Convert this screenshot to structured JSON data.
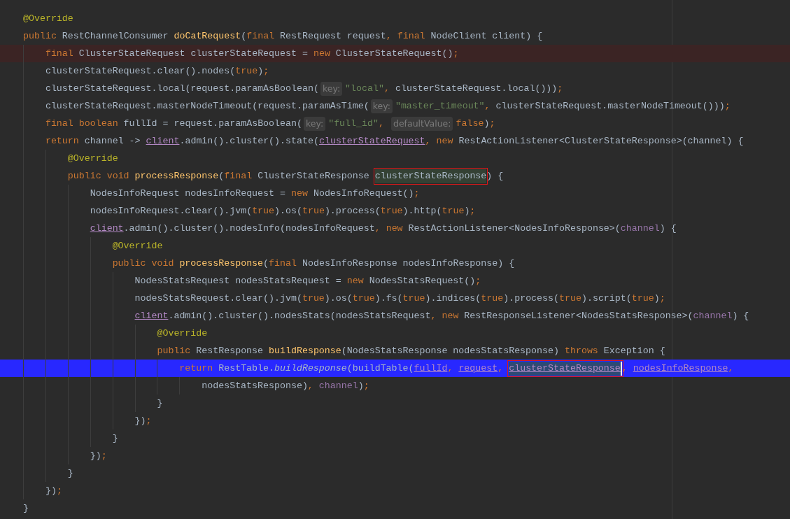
{
  "editor": {
    "lines": [
      {
        "kind": "normal",
        "tokens": [
          {
            "text": "@Override",
            "kind": "annotation"
          }
        ]
      },
      {
        "kind": "normal",
        "tokens": [
          {
            "text": "public",
            "kind": "keyword"
          },
          {
            "text": " RestChannelConsumer ",
            "kind": "plain"
          },
          {
            "text": "doCatRequest",
            "kind": "method"
          },
          {
            "text": "(",
            "kind": "plain"
          },
          {
            "text": "final",
            "kind": "keyword"
          },
          {
            "text": " RestRequest request",
            "kind": "plain"
          },
          {
            "text": ", ",
            "kind": "punct"
          },
          {
            "text": "final",
            "kind": "keyword"
          },
          {
            "text": " NodeClient client) {",
            "kind": "plain"
          }
        ],
        "children": [
          {
            "kind": "breakpoint",
            "tokens": [
              {
                "text": "final",
                "kind": "keyword"
              },
              {
                "text": " ClusterStateRequest clusterStateRequest = ",
                "kind": "plain"
              },
              {
                "text": "new",
                "kind": "keyword"
              },
              {
                "text": " ClusterStateRequest()",
                "kind": "plain"
              },
              {
                "text": ";",
                "kind": "punct"
              }
            ]
          },
          {
            "kind": "normal",
            "tokens": [
              {
                "text": "clusterStateRequest.clear().nodes(",
                "kind": "plain"
              },
              {
                "text": "true",
                "kind": "keyword"
              },
              {
                "text": ")",
                "kind": "plain"
              },
              {
                "text": ";",
                "kind": "punct"
              }
            ]
          },
          {
            "kind": "normal",
            "tokens": [
              {
                "text": "clusterStateRequest.local(request.paramAsBoolean(",
                "kind": "plain"
              },
              {
                "text": "key:",
                "kind": "hint"
              },
              {
                "text": "\"local\"",
                "kind": "string"
              },
              {
                "text": ", ",
                "kind": "punct"
              },
              {
                "text": "clusterStateRequest.local()))",
                "kind": "plain"
              },
              {
                "text": ";",
                "kind": "punct"
              }
            ]
          },
          {
            "kind": "normal",
            "tokens": [
              {
                "text": "clusterStateRequest.masterNodeTimeout(request.paramAsTime(",
                "kind": "plain"
              },
              {
                "text": "key:",
                "kind": "hint"
              },
              {
                "text": "\"master_timeout\"",
                "kind": "string"
              },
              {
                "text": ", ",
                "kind": "punct"
              },
              {
                "text": "clusterStateRequest.masterNodeTimeout()))",
                "kind": "plain"
              },
              {
                "text": ";",
                "kind": "punct"
              }
            ]
          },
          {
            "kind": "normal",
            "tokens": [
              {
                "text": "final boolean",
                "kind": "keyword"
              },
              {
                "text": " fullId = request.paramAsBoolean(",
                "kind": "plain"
              },
              {
                "text": "key:",
                "kind": "hint"
              },
              {
                "text": "\"full_id\"",
                "kind": "string"
              },
              {
                "text": ", ",
                "kind": "punct"
              },
              {
                "text": "defaultValue:",
                "kind": "hint"
              },
              {
                "text": "false",
                "kind": "keyword"
              },
              {
                "text": ")",
                "kind": "plain"
              },
              {
                "text": ";",
                "kind": "punct"
              }
            ]
          },
          {
            "kind": "normal",
            "tokens": [
              {
                "text": "return",
                "kind": "keyword"
              },
              {
                "text": " channel -> ",
                "kind": "plain"
              },
              {
                "text": "client",
                "kind": "link"
              },
              {
                "text": ".admin().cluster().state(",
                "kind": "plain"
              },
              {
                "text": "clusterStateRequest",
                "kind": "link"
              },
              {
                "text": ", ",
                "kind": "punct"
              },
              {
                "text": "new",
                "kind": "keyword"
              },
              {
                "text": " RestActionListener<ClusterStateResponse>(channel) {",
                "kind": "plain"
              }
            ],
            "children": [
              {
                "kind": "normal",
                "tokens": [
                  {
                    "text": "@Override",
                    "kind": "annotation"
                  }
                ]
              },
              {
                "kind": "normal",
                "tokens": [
                  {
                    "text": "public void ",
                    "kind": "keyword"
                  },
                  {
                    "text": "processResponse",
                    "kind": "method"
                  },
                  {
                    "text": "(",
                    "kind": "plain"
                  },
                  {
                    "text": "final",
                    "kind": "keyword"
                  },
                  {
                    "text": " ClusterStateResponse ",
                    "kind": "plain"
                  },
                  {
                    "text": "clusterStateResponse",
                    "kind": "plain",
                    "highlighted": true,
                    "boxed": true
                  },
                  {
                    "text": ") {",
                    "kind": "plain"
                  }
                ],
                "children": [
                  {
                    "kind": "normal",
                    "tokens": [
                      {
                        "text": "NodesInfoRequest nodesInfoRequest = ",
                        "kind": "plain"
                      },
                      {
                        "text": "new",
                        "kind": "keyword"
                      },
                      {
                        "text": " NodesInfoRequest()",
                        "kind": "plain"
                      },
                      {
                        "text": ";",
                        "kind": "punct"
                      }
                    ]
                  },
                  {
                    "kind": "normal",
                    "tokens": [
                      {
                        "text": "nodesInfoRequest.clear().jvm(",
                        "kind": "plain"
                      },
                      {
                        "text": "true",
                        "kind": "keyword"
                      },
                      {
                        "text": ").os(",
                        "kind": "plain"
                      },
                      {
                        "text": "true",
                        "kind": "keyword"
                      },
                      {
                        "text": ").process(",
                        "kind": "plain"
                      },
                      {
                        "text": "true",
                        "kind": "keyword"
                      },
                      {
                        "text": ").http(",
                        "kind": "plain"
                      },
                      {
                        "text": "true",
                        "kind": "keyword"
                      },
                      {
                        "text": ")",
                        "kind": "plain"
                      },
                      {
                        "text": ";",
                        "kind": "punct"
                      }
                    ]
                  },
                  {
                    "kind": "normal",
                    "tokens": [
                      {
                        "text": "client",
                        "kind": "link"
                      },
                      {
                        "text": ".admin().cluster().nodesInfo(nodesInfoRequest",
                        "kind": "plain"
                      },
                      {
                        "text": ", ",
                        "kind": "punct"
                      },
                      {
                        "text": "new",
                        "kind": "keyword"
                      },
                      {
                        "text": " RestActionListener<NodesInfoResponse>(",
                        "kind": "plain"
                      },
                      {
                        "text": "channel",
                        "kind": "field"
                      },
                      {
                        "text": ") {",
                        "kind": "plain"
                      }
                    ],
                    "children": [
                      {
                        "kind": "normal",
                        "tokens": [
                          {
                            "text": "@Override",
                            "kind": "annotation"
                          }
                        ]
                      },
                      {
                        "kind": "normal",
                        "tokens": [
                          {
                            "text": "public void ",
                            "kind": "keyword"
                          },
                          {
                            "text": "processResponse",
                            "kind": "method"
                          },
                          {
                            "text": "(",
                            "kind": "plain"
                          },
                          {
                            "text": "final",
                            "kind": "keyword"
                          },
                          {
                            "text": " NodesInfoResponse nodesInfoResponse) {",
                            "kind": "plain"
                          }
                        ],
                        "children": [
                          {
                            "kind": "normal",
                            "tokens": [
                              {
                                "text": "NodesStatsRequest nodesStatsRequest = ",
                                "kind": "plain"
                              },
                              {
                                "text": "new",
                                "kind": "keyword"
                              },
                              {
                                "text": " NodesStatsRequest()",
                                "kind": "plain"
                              },
                              {
                                "text": ";",
                                "kind": "punct"
                              }
                            ]
                          },
                          {
                            "kind": "normal",
                            "tokens": [
                              {
                                "text": "nodesStatsRequest.clear().jvm(",
                                "kind": "plain"
                              },
                              {
                                "text": "true",
                                "kind": "keyword"
                              },
                              {
                                "text": ").os(",
                                "kind": "plain"
                              },
                              {
                                "text": "true",
                                "kind": "keyword"
                              },
                              {
                                "text": ").fs(",
                                "kind": "plain"
                              },
                              {
                                "text": "true",
                                "kind": "keyword"
                              },
                              {
                                "text": ").indices(",
                                "kind": "plain"
                              },
                              {
                                "text": "true",
                                "kind": "keyword"
                              },
                              {
                                "text": ").process(",
                                "kind": "plain"
                              },
                              {
                                "text": "true",
                                "kind": "keyword"
                              },
                              {
                                "text": ").script(",
                                "kind": "plain"
                              },
                              {
                                "text": "true",
                                "kind": "keyword"
                              },
                              {
                                "text": ")",
                                "kind": "plain"
                              },
                              {
                                "text": ";",
                                "kind": "punct"
                              }
                            ]
                          },
                          {
                            "kind": "normal",
                            "tokens": [
                              {
                                "text": "client",
                                "kind": "link"
                              },
                              {
                                "text": ".admin().cluster().nodesStats(nodesStatsRequest",
                                "kind": "plain"
                              },
                              {
                                "text": ", ",
                                "kind": "punct"
                              },
                              {
                                "text": "new",
                                "kind": "keyword"
                              },
                              {
                                "text": " RestResponseListener<NodesStatsResponse>(",
                                "kind": "plain"
                              },
                              {
                                "text": "channel",
                                "kind": "field"
                              },
                              {
                                "text": ") {",
                                "kind": "plain"
                              }
                            ],
                            "children": [
                              {
                                "kind": "normal",
                                "tokens": [
                                  {
                                    "text": "@Override",
                                    "kind": "annotation"
                                  }
                                ]
                              },
                              {
                                "kind": "normal",
                                "tokens": [
                                  {
                                    "text": "public",
                                    "kind": "keyword"
                                  },
                                  {
                                    "text": " RestResponse ",
                                    "kind": "plain"
                                  },
                                  {
                                    "text": "buildResponse",
                                    "kind": "method"
                                  },
                                  {
                                    "text": "(NodesStatsResponse nodesStatsResponse) ",
                                    "kind": "plain"
                                  },
                                  {
                                    "text": "throws",
                                    "kind": "keyword"
                                  },
                                  {
                                    "text": " Exception {",
                                    "kind": "plain"
                                  }
                                ],
                                "children": [
                                  {
                                    "kind": "current",
                                    "tokens": [
                                      {
                                        "text": "return",
                                        "kind": "keyword"
                                      },
                                      {
                                        "text": " RestTable.",
                                        "kind": "plain"
                                      },
                                      {
                                        "text": "buildResponse",
                                        "kind": "italic"
                                      },
                                      {
                                        "text": "(buildTable(",
                                        "kind": "plain"
                                      },
                                      {
                                        "text": "fullId",
                                        "kind": "link"
                                      },
                                      {
                                        "text": ", ",
                                        "kind": "punct"
                                      },
                                      {
                                        "text": "request",
                                        "kind": "link"
                                      },
                                      {
                                        "text": ", ",
                                        "kind": "punct"
                                      },
                                      {
                                        "text": "clusterStateResponse",
                                        "kind": "link",
                                        "highlighted": true,
                                        "boxed": true,
                                        "caret": true
                                      },
                                      {
                                        "text": ", ",
                                        "kind": "punct"
                                      },
                                      {
                                        "text": "nodesInfoResponse",
                                        "kind": "link"
                                      },
                                      {
                                        "text": ",",
                                        "kind": "punct"
                                      }
                                    ],
                                    "children": [
                                      {
                                        "kind": "normal",
                                        "tokens": [
                                          {
                                            "text": "nodesStatsResponse)",
                                            "kind": "plain"
                                          },
                                          {
                                            "text": ", ",
                                            "kind": "punct"
                                          },
                                          {
                                            "text": "channel",
                                            "kind": "field"
                                          },
                                          {
                                            "text": ")",
                                            "kind": "plain"
                                          },
                                          {
                                            "text": ";",
                                            "kind": "punct"
                                          }
                                        ]
                                      }
                                    ]
                                  }
                                ]
                              },
                              {
                                "kind": "normal",
                                "tokens": [
                                  {
                                    "text": "}",
                                    "kind": "plain"
                                  }
                                ]
                              }
                            ]
                          },
                          {
                            "kind": "normal",
                            "tokens": [
                              {
                                "text": "})",
                                "kind": "plain"
                              },
                              {
                                "text": ";",
                                "kind": "punct"
                              }
                            ]
                          }
                        ]
                      },
                      {
                        "kind": "normal",
                        "tokens": [
                          {
                            "text": "}",
                            "kind": "plain"
                          }
                        ]
                      }
                    ]
                  },
                  {
                    "kind": "normal",
                    "tokens": [
                      {
                        "text": "})",
                        "kind": "plain"
                      },
                      {
                        "text": ";",
                        "kind": "punct"
                      }
                    ]
                  }
                ]
              },
              {
                "kind": "normal",
                "tokens": [
                  {
                    "text": "}",
                    "kind": "plain"
                  }
                ]
              }
            ]
          },
          {
            "kind": "normal",
            "tokens": [
              {
                "text": "})",
                "kind": "plain"
              },
              {
                "text": ";",
                "kind": "punct"
              }
            ]
          }
        ]
      },
      {
        "kind": "normal",
        "tokens": [
          {
            "text": "}",
            "kind": "plain"
          }
        ]
      }
    ]
  }
}
